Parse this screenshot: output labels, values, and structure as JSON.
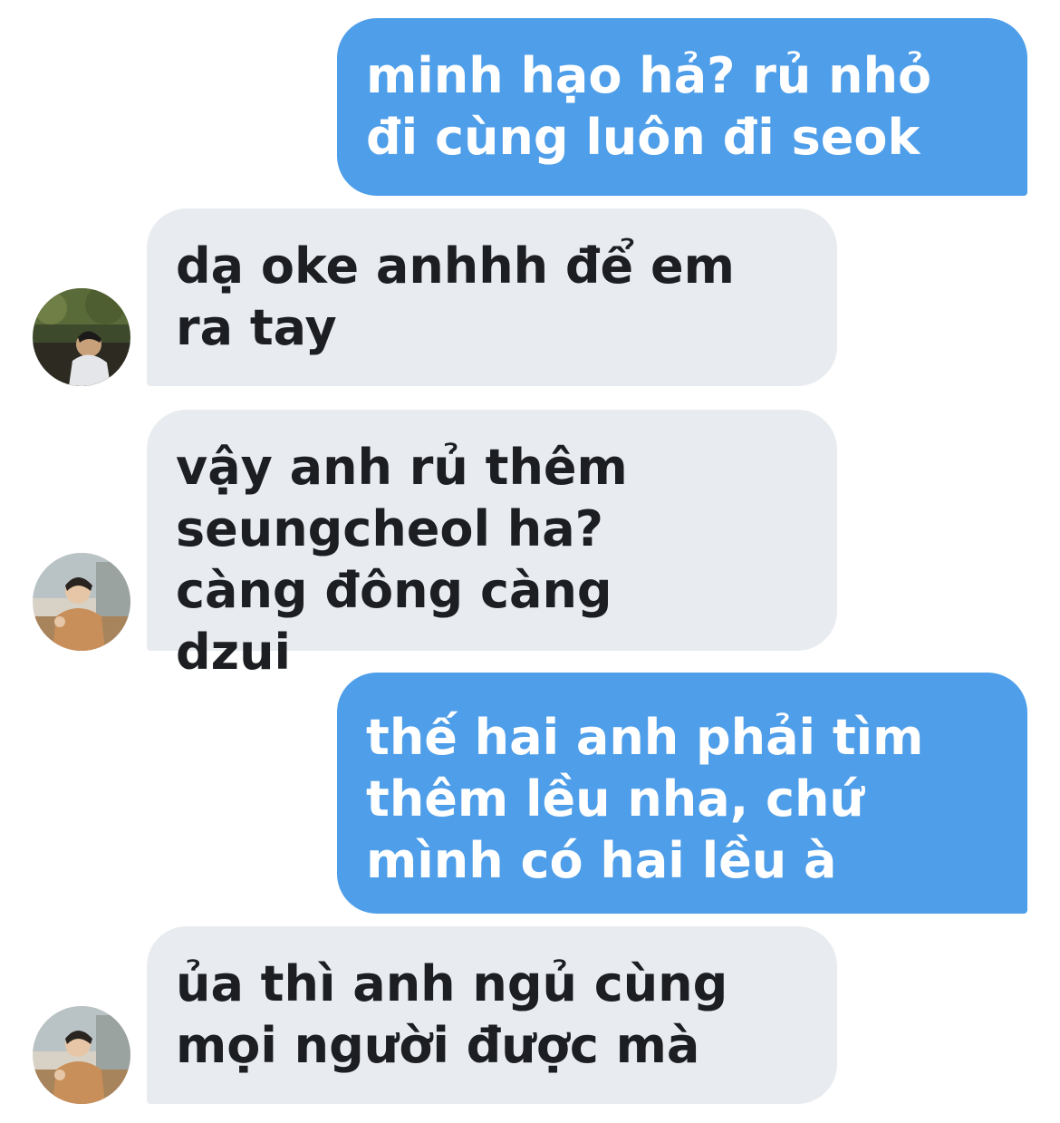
{
  "conversation": {
    "messages": [
      {
        "direction": "sent",
        "text": "minh hạo hả? rủ nhỏ đi cùng luôn đi seok"
      },
      {
        "direction": "received",
        "text": "dạ oke anhhh để em ra tay",
        "avatar": "avatar-forest-photo"
      },
      {
        "direction": "received",
        "text": "vậy anh rủ thêm seungcheol ha? càng đông càng dzui",
        "avatar": "avatar-cafe-photo"
      },
      {
        "direction": "sent",
        "text": "thế hai anh phải tìm thêm lều nha, chứ mình có hai lều à"
      },
      {
        "direction": "received",
        "text": "ủa thì anh ngủ cùng mọi người được mà",
        "avatar": "avatar-cafe-photo"
      }
    ]
  },
  "colors": {
    "sent_bubble": "#4e9ee9",
    "received_bubble": "#e8ebef",
    "sent_text": "#ffffff",
    "received_text": "#1c1e21"
  }
}
